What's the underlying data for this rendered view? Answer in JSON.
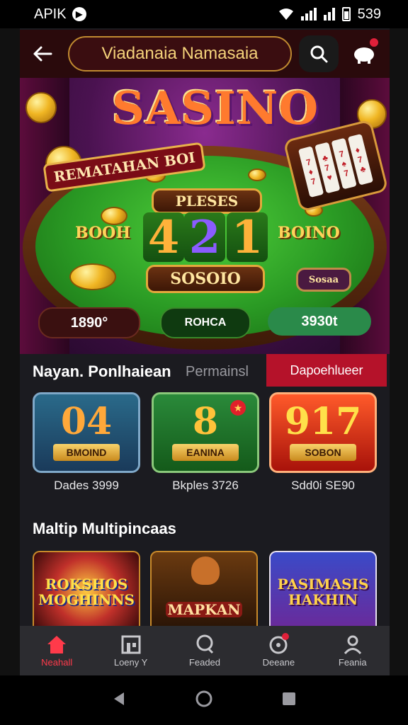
{
  "status_bar": {
    "left_text": "APIK",
    "time": "539"
  },
  "header": {
    "title": "Viadanaia Namasaia"
  },
  "banner": {
    "logo": "SASINO",
    "sign_text": "REMATAHAN BOI",
    "top_plate": "PLESES",
    "digits": [
      "4",
      "2",
      "1"
    ],
    "left_word": "BOOH",
    "right_word": "BOINO",
    "bottom_plate": "SOSOIO",
    "side_badge": "Sosaa",
    "stats": {
      "left": "1890°",
      "center": "ROHCA",
      "right": "3930t"
    }
  },
  "section1": {
    "title": "Nayan. Ponlhaiean",
    "subtitle": "Permainsl",
    "tab_label": "Dapoehlueer",
    "tiles": [
      {
        "number": "04",
        "tag": "BMOIND",
        "caption": "Dades 3999"
      },
      {
        "number": "8",
        "tag": "EANINA",
        "caption": "Bkples 3726"
      },
      {
        "number": "917",
        "tag": "SOBON",
        "caption": "Sdd0i SE90"
      }
    ]
  },
  "section2": {
    "title": "Maltip Multipincaas",
    "games": [
      {
        "title": "ROKSHOS MOGHINNS"
      },
      {
        "title": "MAPKAN"
      },
      {
        "title": "PASIMASIS HAKHIN"
      }
    ]
  },
  "bottom_nav": [
    {
      "label": "Neahall",
      "icon": "home-icon",
      "active": true
    },
    {
      "label": "Loeny Y",
      "icon": "store-icon",
      "active": false
    },
    {
      "label": "Feaded",
      "icon": "chat-icon",
      "active": false
    },
    {
      "label": "Deeane",
      "icon": "gamepad-icon",
      "active": false
    },
    {
      "label": "Feania",
      "icon": "profile-icon",
      "active": false
    }
  ],
  "colors": {
    "accent": "#b5122a",
    "gold": "#e8b24a",
    "active_nav": "#ff3a4a"
  }
}
